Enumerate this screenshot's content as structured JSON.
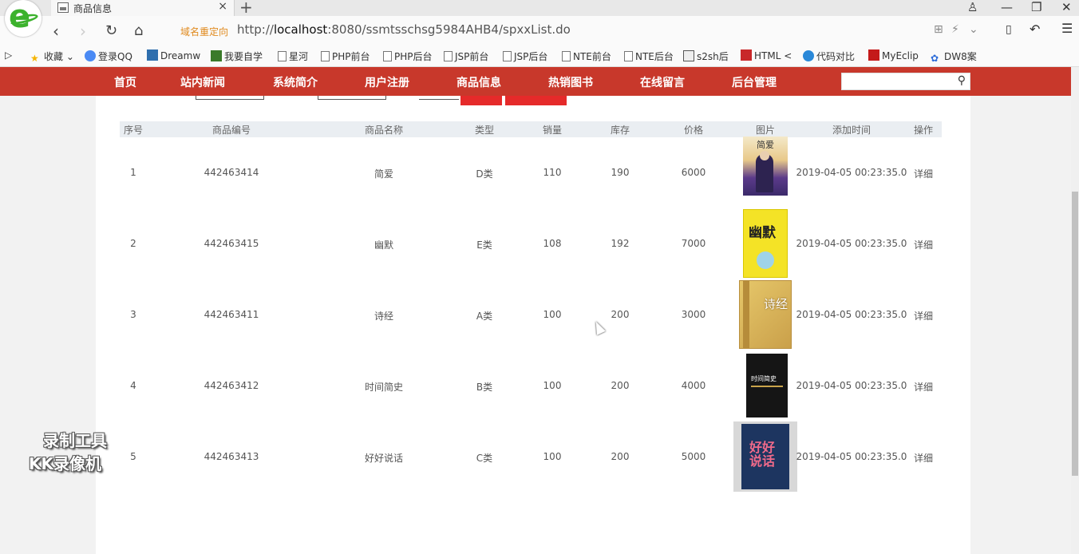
{
  "browser": {
    "tab_title": "商品信息",
    "tab_close": "×",
    "new_tab": "+",
    "redirect_label": "域名重定向",
    "url_prefix": "http://",
    "url_host": "localhost",
    "url_rest": ":8080/ssmtsschsg5984AHB4/spxxList.do",
    "bookmarks": [
      "收藏",
      "登录QQ",
      "Dreamw",
      "我要自学",
      "星河",
      "PHP前台",
      "PHP后台",
      "JSP前台",
      "JSP后台",
      "NTE前台",
      "NTE后台",
      "s2sh后",
      "HTML <",
      "代码对比",
      "MyEclip",
      "DW8案"
    ]
  },
  "nav": {
    "items": [
      "首页",
      "站内新闻",
      "系统简介",
      "用户注册",
      "商品信息",
      "热销图书",
      "在线留言",
      "后台管理"
    ],
    "search_placeholder": ""
  },
  "table": {
    "headers": [
      "序号",
      "商品编号",
      "商品名称",
      "类型",
      "销量",
      "库存",
      "价格",
      "图片",
      "添加时间",
      "操作"
    ],
    "rows": [
      {
        "seq": "1",
        "code": "442463414",
        "name": "简爱",
        "type": "D类",
        "sales": "110",
        "stock": "190",
        "price": "6000",
        "added": "2019-04-05 00:23:35.0",
        "action": "详细",
        "cover_text": "简爱"
      },
      {
        "seq": "2",
        "code": "442463415",
        "name": "幽默",
        "type": "E类",
        "sales": "108",
        "stock": "192",
        "price": "7000",
        "added": "2019-04-05 00:23:35.0",
        "action": "详细",
        "cover_text": "幽默"
      },
      {
        "seq": "3",
        "code": "442463411",
        "name": "诗经",
        "type": "A类",
        "sales": "100",
        "stock": "200",
        "price": "3000",
        "added": "2019-04-05 00:23:35.0",
        "action": "详细",
        "cover_text": "诗经"
      },
      {
        "seq": "4",
        "code": "442463412",
        "name": "时间简史",
        "type": "B类",
        "sales": "100",
        "stock": "200",
        "price": "4000",
        "added": "2019-04-05 00:23:35.0",
        "action": "详细",
        "cover_text": "时间简史"
      },
      {
        "seq": "5",
        "code": "442463413",
        "name": "好好说话",
        "type": "C类",
        "sales": "100",
        "stock": "200",
        "price": "5000",
        "added": "2019-04-05 00:23:35.0",
        "action": "详细",
        "cover_text": "好好说话"
      }
    ]
  },
  "watermark": {
    "line1": "录制工具",
    "line2": "KK录像机"
  },
  "colors": {
    "nav_bg": "#c8382b",
    "button_red": "#e52a2a",
    "header_bg": "#eaeef2"
  }
}
